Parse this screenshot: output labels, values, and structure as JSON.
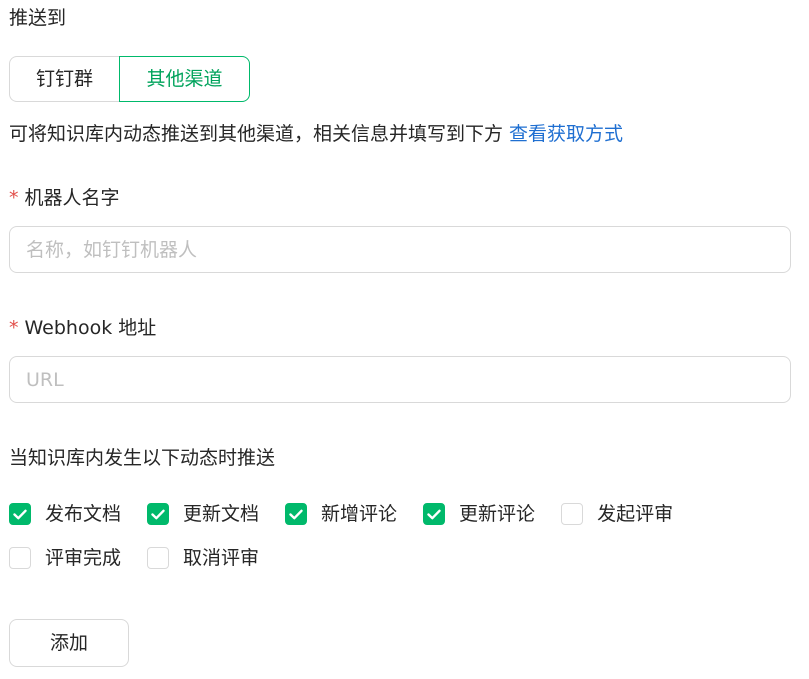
{
  "section_title": "推送到",
  "channel_tabs": [
    {
      "label": "钉钉群",
      "active": false
    },
    {
      "label": "其他渠道",
      "active": true
    }
  ],
  "description": {
    "text": "可将知识库内动态推送到其他渠道，相关信息并填写到下方",
    "link": "查看获取方式"
  },
  "robot_name": {
    "required_mark": "*",
    "label": "机器人名字",
    "placeholder": "名称，如钉钉机器人",
    "value": ""
  },
  "webhook": {
    "required_mark": "*",
    "label": "Webhook 地址",
    "placeholder": "URL",
    "value": ""
  },
  "events": {
    "title": "当知识库内发生以下动态时推送",
    "options": [
      {
        "label": "发布文档",
        "checked": true
      },
      {
        "label": "更新文档",
        "checked": true
      },
      {
        "label": "新增评论",
        "checked": true
      },
      {
        "label": "更新评论",
        "checked": true
      },
      {
        "label": "发起评审",
        "checked": false
      },
      {
        "label": "评审完成",
        "checked": false
      },
      {
        "label": "取消评审",
        "checked": false
      }
    ]
  },
  "add_button": "添加",
  "colors": {
    "accent": "#00b96b",
    "link": "#1f6fd1",
    "required": "#e2504b"
  }
}
